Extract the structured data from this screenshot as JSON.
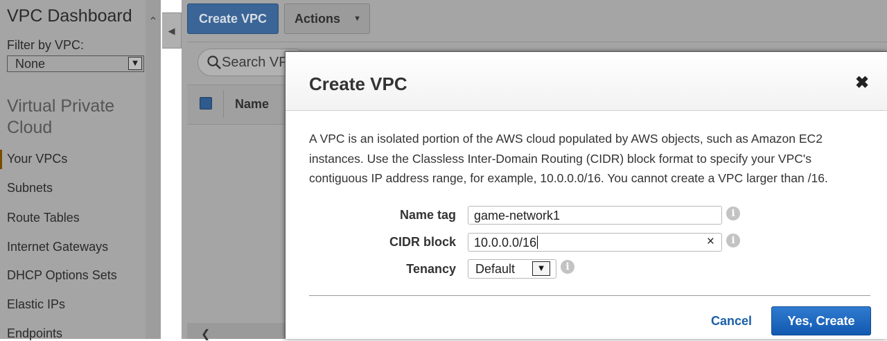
{
  "sidebar": {
    "title": "VPC Dashboard",
    "filter_label": "Filter by VPC:",
    "filter_value": "None",
    "section_title": "Virtual Private Cloud",
    "items": [
      {
        "label": "Your VPCs",
        "active": true
      },
      {
        "label": "Subnets"
      },
      {
        "label": "Route Tables"
      },
      {
        "label": "Internet Gateways"
      },
      {
        "label": "DHCP Options Sets"
      },
      {
        "label": "Elastic IPs"
      },
      {
        "label": "Endpoints"
      }
    ]
  },
  "toolbar": {
    "create_label": "Create VPC",
    "actions_label": "Actions"
  },
  "search": {
    "placeholder": "Search VPCs"
  },
  "table": {
    "columns": [
      "Name"
    ]
  },
  "modal": {
    "title": "Create VPC",
    "description": "A VPC is an isolated portion of the AWS cloud populated by AWS objects, such as Amazon EC2 instances. Use the Classless Inter-Domain Routing (CIDR) block format to specify your VPC's contiguous IP address range, for example, 10.0.0.0/16. You cannot create a VPC larger than /16.",
    "fields": {
      "name_tag": {
        "label": "Name tag",
        "value": "game-network1"
      },
      "cidr_block": {
        "label": "CIDR block",
        "value": "10.0.0.0/16"
      },
      "tenancy": {
        "label": "Tenancy",
        "value": "Default"
      }
    },
    "cancel_label": "Cancel",
    "confirm_label": "Yes, Create"
  },
  "colors": {
    "primary_button": "#1565c0",
    "link": "#1a5fa8",
    "overlay": "#a5a5a5"
  }
}
